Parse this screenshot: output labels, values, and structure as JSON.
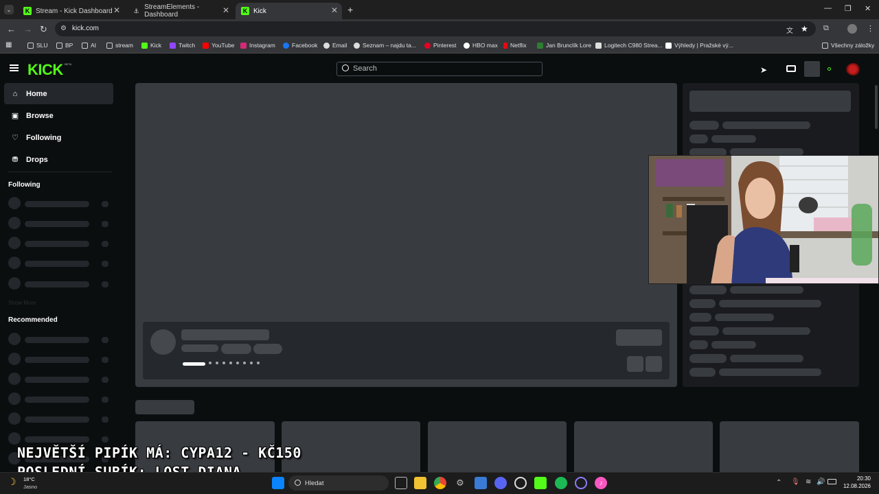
{
  "browser": {
    "tabs": [
      {
        "title": "Stream - Kick Dashboard"
      },
      {
        "title": "StreamElements - Dashboard"
      },
      {
        "title": "Kick"
      }
    ],
    "url": "kick.com",
    "bookmarks": [
      "SLU",
      "BP",
      "AI",
      "stream",
      "Kick",
      "Twitch",
      "YouTube",
      "Instagram",
      "Facebook",
      "Email",
      "Seznam – najdu ta...",
      "Pinterest",
      "HBO max",
      "Netflix",
      "Jan Brunclík Lore",
      "Logitech C980 Strea...",
      "Výhledy | Pražské vý...",
      "Všechny záložky"
    ]
  },
  "kick": {
    "logo": "KICK",
    "logo_badge": "BETA",
    "search_placeholder": "Search",
    "nav": [
      "Home",
      "Browse",
      "Following",
      "Drops"
    ],
    "sections": {
      "following": "Following",
      "show_more": "Show More",
      "recommended": "Recommended"
    }
  },
  "overlay": {
    "line1": "NEJVĚTŠÍ PIPÍK MÁ: CYPA12 - KČ150",
    "line2": "POSLEDNÍ SUBÍK: LOST_DIANA"
  },
  "taskbar": {
    "weather_temp": "18°C",
    "weather_text": "Jasno",
    "search": "Hledat",
    "time": "20:30",
    "date": "12.08.2026"
  },
  "colors": {
    "kick_green": "#53fc18",
    "bg": "#0b0e0f",
    "skeleton": "#383b40"
  }
}
